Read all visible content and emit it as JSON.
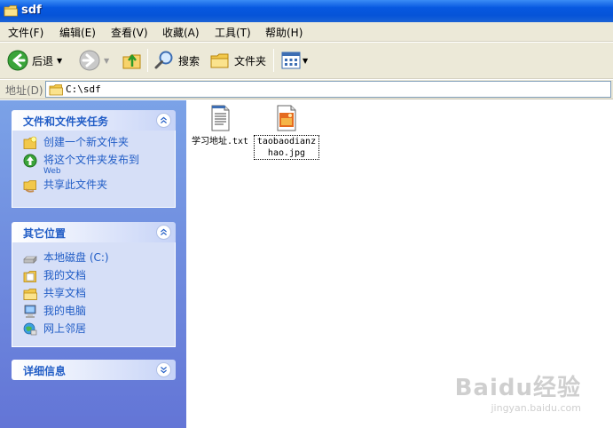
{
  "window": {
    "title": "sdf"
  },
  "menu": [
    "文件(F)",
    "编辑(E)",
    "查看(V)",
    "收藏(A)",
    "工具(T)",
    "帮助(H)"
  ],
  "toolbar": {
    "back": "后退",
    "search": "搜索",
    "folders": "文件夹"
  },
  "address": {
    "label": "地址(D)",
    "path": "C:\\sdf"
  },
  "tasks_panel": {
    "title": "文件和文件夹任务",
    "items": [
      {
        "label": "创建一个新文件夹",
        "icon": "new-folder-icon"
      },
      {
        "label": "将这个文件夹发布到",
        "sub": "Web",
        "icon": "publish-web-icon"
      },
      {
        "label": "共享此文件夹",
        "icon": "share-folder-icon"
      }
    ]
  },
  "places_panel": {
    "title": "其它位置",
    "items": [
      {
        "label": "本地磁盘 (C:)",
        "icon": "local-disk-icon"
      },
      {
        "label": "我的文档",
        "icon": "my-documents-icon"
      },
      {
        "label": "共享文档",
        "icon": "shared-documents-icon"
      },
      {
        "label": "我的电脑",
        "icon": "my-computer-icon"
      },
      {
        "label": "网上邻居",
        "icon": "network-places-icon"
      }
    ]
  },
  "details_panel": {
    "title": "详细信息"
  },
  "files": [
    {
      "name": "学习地址.txt",
      "icon": "text-file-icon"
    },
    {
      "name": "taobaodianzhao.jpg",
      "icon": "image-file-icon",
      "selected": true
    }
  ],
  "watermark": {
    "main": "Baidu经验",
    "sub": "jingyan.baidu.com"
  },
  "colors": {
    "titlebar": "#0654d8",
    "taskpane": "#7ba2e7",
    "link": "#215dc6",
    "chrome": "#ece9d8"
  }
}
